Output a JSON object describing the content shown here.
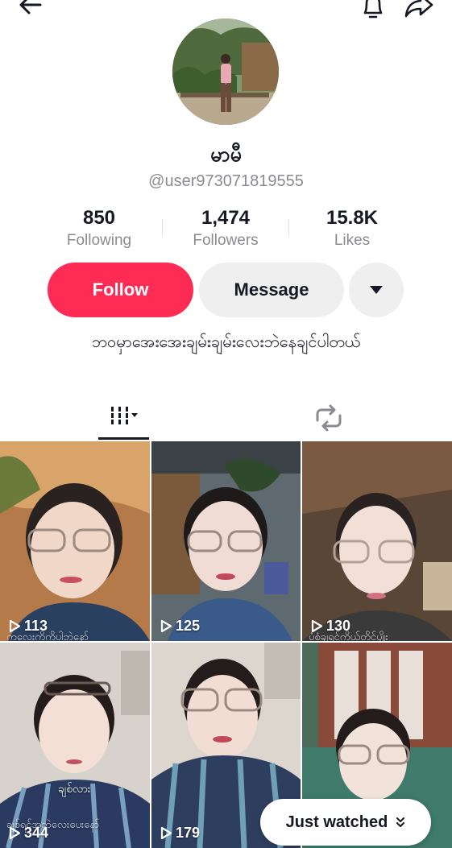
{
  "header": {
    "back_icon": "arrow-left-icon",
    "notification_icon": "bell-icon",
    "share_icon": "share-arrow-icon"
  },
  "profile": {
    "display_name": "မာမီ",
    "username": "@user973071819555",
    "bio": "ဘဝမှာအေးအေးချမ်းချမ်းလေးဘဲနေချင်ပါတယ်"
  },
  "stats": [
    {
      "value": "850",
      "label": "Following"
    },
    {
      "value": "1,474",
      "label": "Followers"
    },
    {
      "value": "15.8K",
      "label": "Likes"
    }
  ],
  "actions": {
    "follow_label": "Follow",
    "message_label": "Message",
    "follow_color": "#fe2c55"
  },
  "tabs": {
    "videos_icon": "grid-videos-icon",
    "repost_icon": "repost-icon"
  },
  "videos": [
    {
      "views": "113",
      "caption": "ကလေးကိုကိုပါဘဲနော်"
    },
    {
      "views": "125",
      "caption": ""
    },
    {
      "views": "130",
      "caption": "ပုံစံချရင်ကိုယ်တိုင်ပျိုး"
    },
    {
      "views": "344",
      "caption": "ချစ်ရင်အဘဲလေးပေးနော်",
      "overlay": "ချစ်လား"
    },
    {
      "views": "179",
      "caption": ""
    },
    {
      "views": "",
      "caption": ""
    }
  ],
  "floating": {
    "just_watched_label": "Just watched"
  }
}
